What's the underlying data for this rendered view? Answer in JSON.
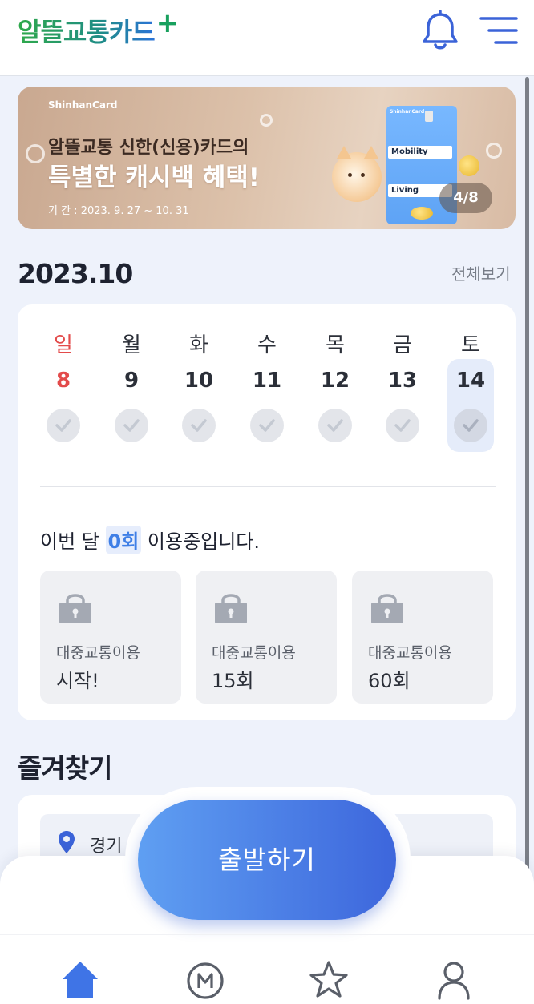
{
  "app": {
    "logo_text": "알뜰교통카드",
    "logo_plus": "+"
  },
  "header": {
    "bell_icon": "bell-icon",
    "menu_icon": "hamburger-menu-icon"
  },
  "banner": {
    "brand": "ShinhanCard",
    "line1": "알뜰교통 신한(신용)카드의",
    "line2": "특별한 캐시백 혜택!",
    "period": "기 간 : 2023. 9. 27 ~ 10. 31",
    "card_brand": "ShinhanCard",
    "card_row1": "Mobility",
    "card_row2": "Living",
    "pager": "4/8"
  },
  "calendar": {
    "month": "2023.10",
    "view_all": "전체보기",
    "days": [
      {
        "name": "일",
        "num": "8"
      },
      {
        "name": "월",
        "num": "9"
      },
      {
        "name": "화",
        "num": "10"
      },
      {
        "name": "수",
        "num": "11"
      },
      {
        "name": "목",
        "num": "12"
      },
      {
        "name": "금",
        "num": "13"
      },
      {
        "name": "토",
        "num": "14"
      }
    ],
    "usage_prefix": "이번 달 ",
    "usage_count": "0회",
    "usage_suffix": " 이용중입니다.",
    "tiles": [
      {
        "label": "대중교통이용",
        "value": "시작!"
      },
      {
        "label": "대중교통이용",
        "value": "15회"
      },
      {
        "label": "대중교통이용",
        "value": "60회"
      }
    ]
  },
  "favorites": {
    "title": "즐겨찾기",
    "first_item": "경기"
  },
  "cta": {
    "label": "출발하기"
  },
  "bottom_nav": {
    "items": [
      "home-icon",
      "m-pass-icon",
      "star-icon",
      "user-icon"
    ]
  },
  "colors": {
    "accent": "#3f7fe6",
    "sunday": "#e34b4b",
    "cta_start": "#5f9ff2",
    "cta_end": "#3d66dc",
    "background": "#eef2fb"
  }
}
